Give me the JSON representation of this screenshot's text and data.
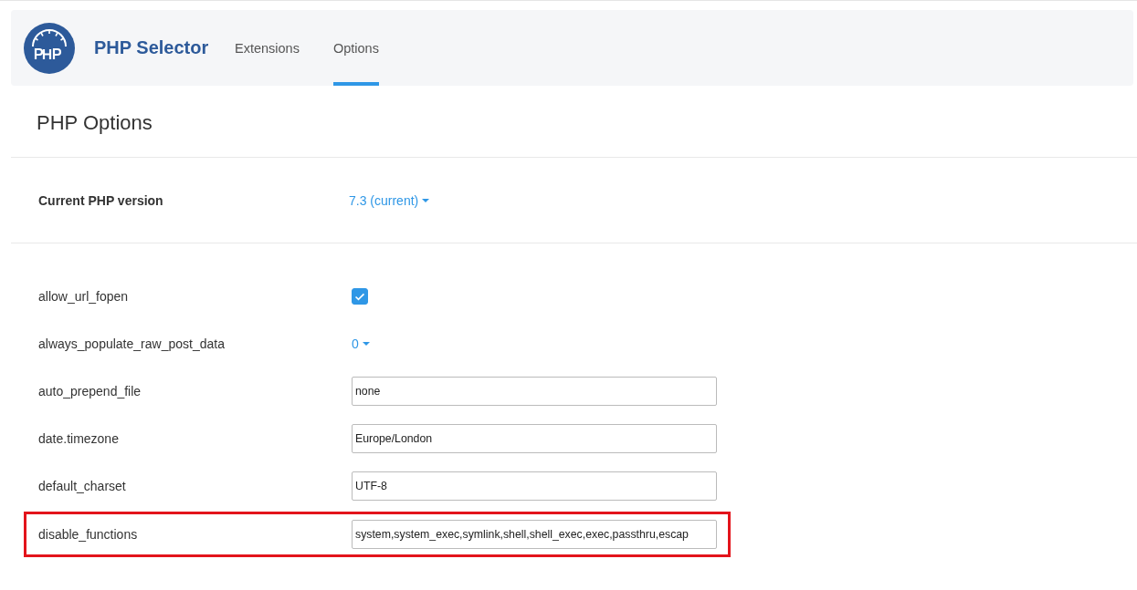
{
  "header": {
    "title": "PHP Selector",
    "tabs": [
      {
        "label": "Extensions",
        "selected": false
      },
      {
        "label": "Options",
        "selected": true
      }
    ]
  },
  "page_title": "PHP Options",
  "version": {
    "label": "Current PHP version",
    "value": "7.3 (current)"
  },
  "options": [
    {
      "name": "allow_url_fopen",
      "kind": "checkbox",
      "checked": true,
      "highlighted": false
    },
    {
      "name": "always_populate_raw_post_data",
      "kind": "select",
      "value": "0",
      "highlighted": false
    },
    {
      "name": "auto_prepend_file",
      "kind": "text",
      "value": "none",
      "highlighted": false
    },
    {
      "name": "date.timezone",
      "kind": "text",
      "value": "Europe/London",
      "highlighted": false
    },
    {
      "name": "default_charset",
      "kind": "text",
      "value": "UTF-8",
      "highlighted": false
    },
    {
      "name": "disable_functions",
      "kind": "text",
      "value": "system,system_exec,symlink,shell,shell_exec,exec,passthru,escap",
      "highlighted": true
    }
  ]
}
